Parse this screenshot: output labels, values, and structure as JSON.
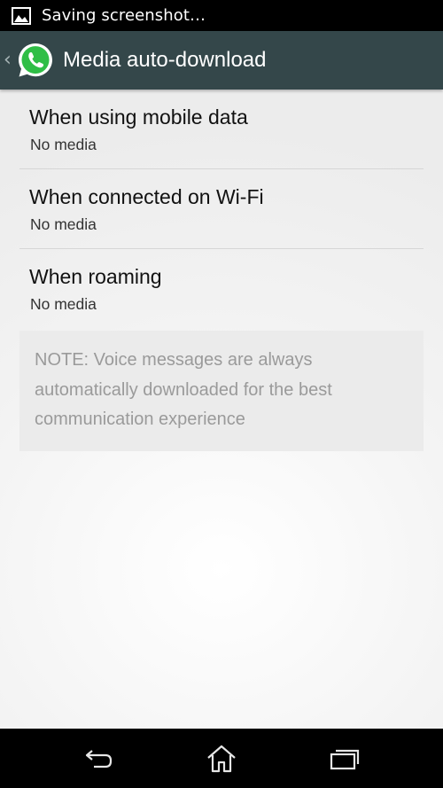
{
  "status_bar": {
    "notification_icon": "image-icon",
    "text": "Saving screenshot…"
  },
  "action_bar": {
    "up_icon": "chevron-left-icon",
    "app_logo": "whatsapp-logo",
    "title": "Media auto-download",
    "background_color": "#34474a",
    "logo_color": "#25d366"
  },
  "preferences": [
    {
      "title": "When using mobile data",
      "summary": "No media"
    },
    {
      "title": "When connected on Wi-Fi",
      "summary": "No media"
    },
    {
      "title": "When roaming",
      "summary": "No media"
    }
  ],
  "note": {
    "lines": [
      "NOTE: Voice messages are always",
      "automatically downloaded for the best",
      "communication experience"
    ]
  },
  "nav_bar": {
    "buttons": [
      "back-icon",
      "home-icon",
      "recents-icon"
    ]
  }
}
